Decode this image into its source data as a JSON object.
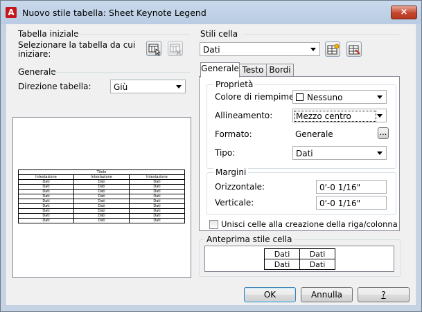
{
  "window": {
    "title": "Nuovo stile tabella: Sheet Keynote Legend",
    "close_symbol": "×"
  },
  "left": {
    "start_group": "Tabella iniziale",
    "start_prompt": "Selezionare la tabella da cui iniziare:",
    "general_group": "Generale",
    "direction_label": "Direzione tabella:",
    "direction_value": "Giù",
    "preview": {
      "title": "Titolo",
      "header": [
        "Intestazione",
        "Intestazione",
        "Intestazione"
      ],
      "rows": [
        [
          "Dati",
          "Dati",
          "Dati"
        ],
        [
          "Dati",
          "Dati",
          "Dati"
        ],
        [
          "Dati",
          "Dati",
          "Dati"
        ],
        [
          "Dati",
          "Dati",
          "Dati"
        ],
        [
          "Dati",
          "Dati",
          "Dati"
        ],
        [
          "Dati",
          "Dati",
          "Dati"
        ],
        [
          "Dati",
          "Dati",
          "Dati"
        ],
        [
          "Dati",
          "Dati",
          "Dati"
        ],
        [
          "Dati",
          "Dati",
          "Dati"
        ]
      ]
    }
  },
  "right": {
    "cell_styles_group": "Stili cella",
    "cell_style_value": "Dati",
    "tabs": [
      {
        "label": "Generale",
        "active": true
      },
      {
        "label": "Testo",
        "active": false
      },
      {
        "label": "Bordi",
        "active": false
      }
    ],
    "properties_group": "Proprietà",
    "fill_label": "Colore di riempimento:",
    "fill_value": "Nessuno",
    "align_label": "Allineamento:",
    "align_value": "Mezzo centro",
    "format_label": "Formato:",
    "format_value": "Generale",
    "format_button": "...",
    "type_label": "Tipo:",
    "type_value": "Dati",
    "margins_group": "Margini",
    "horizontal_label": "Orizzontale:",
    "horizontal_value": "0'-0 1/16\"",
    "vertical_label": "Verticale:",
    "vertical_value": "0'-0 1/16\"",
    "merge_label": "Unisci celle alla creazione della riga/colonna",
    "merge_checked": false,
    "cell_preview_group": "Anteprima stile cella",
    "cell_preview": [
      [
        "Dati",
        "Dati"
      ],
      [
        "Dati",
        "Dati"
      ]
    ]
  },
  "buttons": {
    "ok": "OK",
    "cancel": "Annulla",
    "help": "?"
  }
}
